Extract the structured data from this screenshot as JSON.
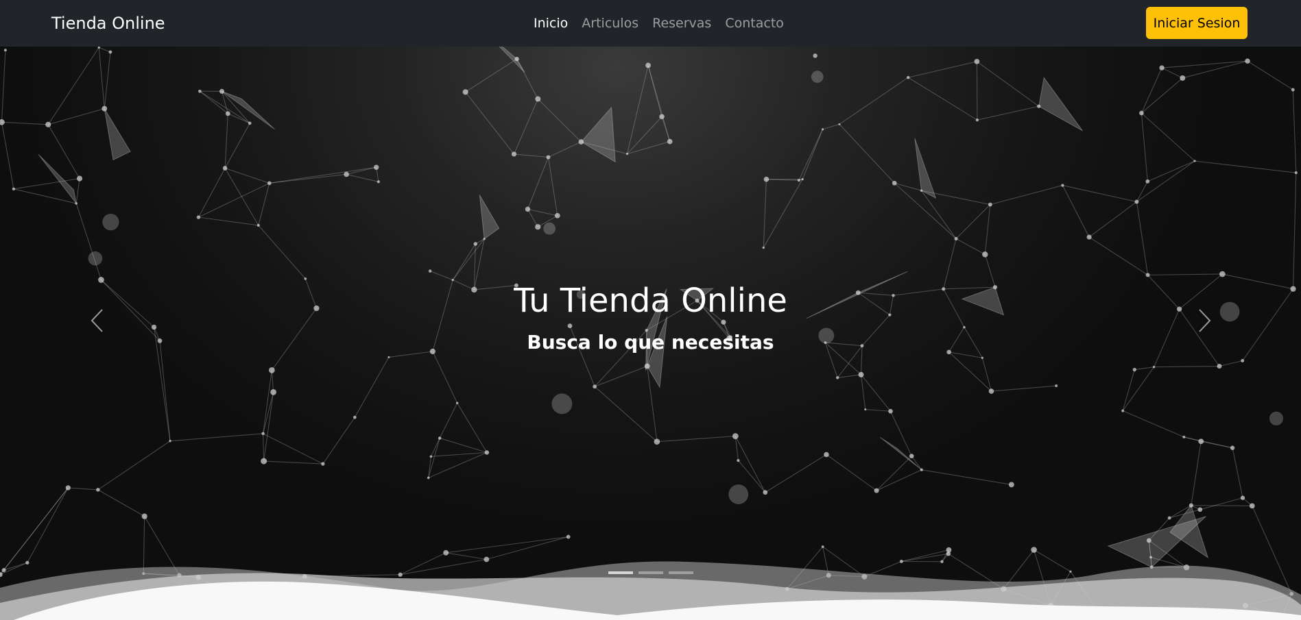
{
  "navbar": {
    "brand": "Tienda Online",
    "links": [
      {
        "label": "Inicio",
        "active": true
      },
      {
        "label": "Articulos",
        "active": false
      },
      {
        "label": "Reservas",
        "active": false
      },
      {
        "label": "Contacto",
        "active": false
      }
    ],
    "login_label": "Iniciar Sesion",
    "login_color": "#ffc107",
    "background": "#212529"
  },
  "hero": {
    "title": "Tu Tienda Online",
    "subtitle": "Busca lo que necesitas",
    "prev_icon": "chevron-left-icon",
    "next_icon": "chevron-right-icon",
    "slides_count": 3,
    "active_slide": 1
  }
}
